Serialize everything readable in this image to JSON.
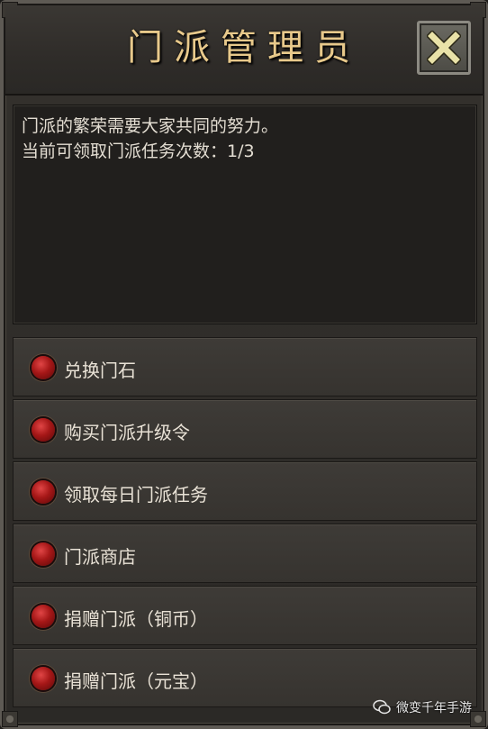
{
  "window": {
    "title": "门派管理员"
  },
  "description": {
    "line1": "门派的繁荣需要大家共同的努力。",
    "line2": "当前可领取门派任务次数：1/3"
  },
  "menu": {
    "items": [
      {
        "label": "兑换门石"
      },
      {
        "label": "购买门派升级令"
      },
      {
        "label": "领取每日门派任务"
      },
      {
        "label": "门派商店"
      },
      {
        "label": "捐赠门派（铜币）"
      },
      {
        "label": "捐赠门派（元宝）"
      }
    ]
  },
  "watermark": {
    "text": "微变千年手游"
  },
  "colors": {
    "title_gold": "#e8c98b",
    "bullet_red": "#a51717",
    "close_x": "#e9e2a8"
  }
}
